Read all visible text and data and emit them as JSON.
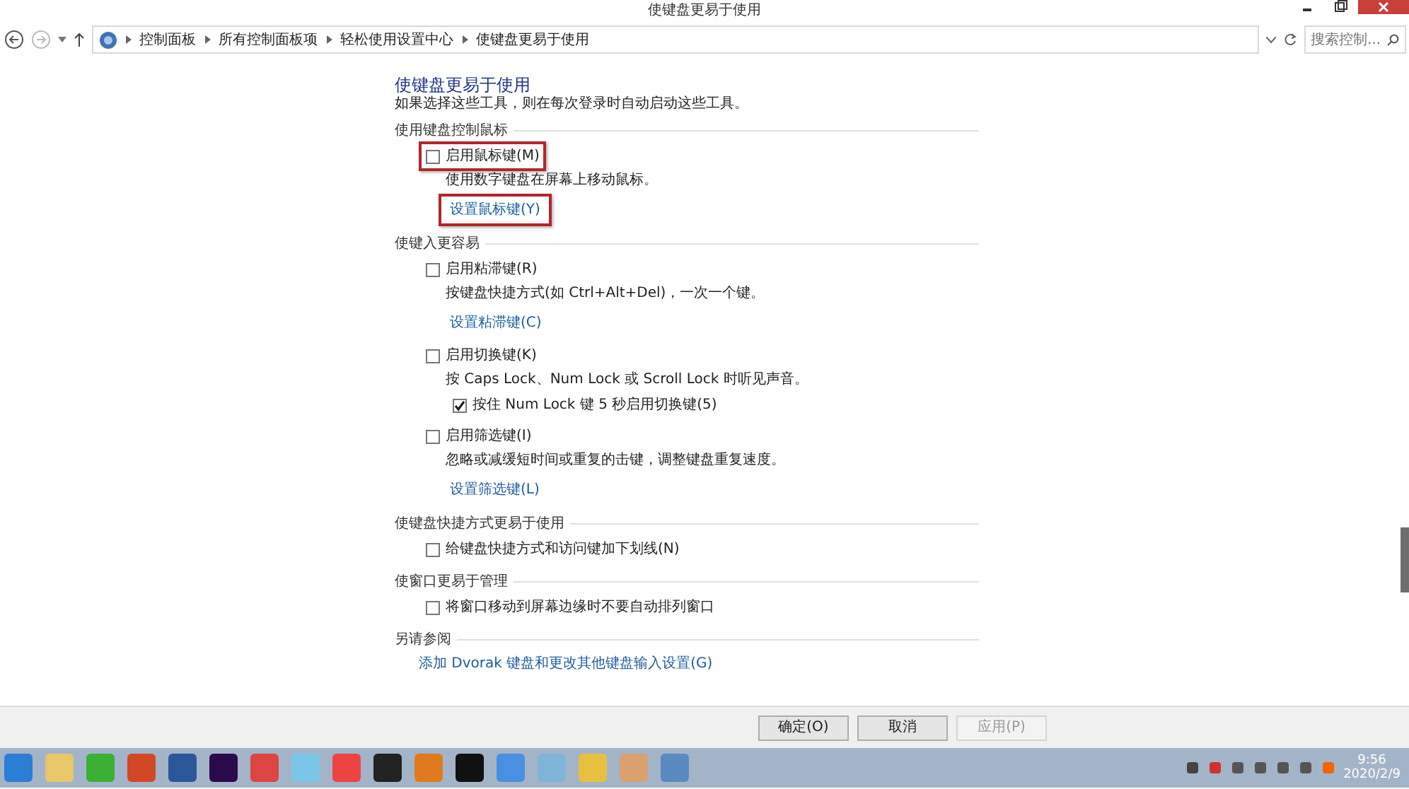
{
  "window": {
    "title": "使键盘更易于使用"
  },
  "address_bar": {
    "breadcrumb": [
      "控制面板",
      "所有控制面板项",
      "轻松使用设置中心",
      "使键盘更易于使用"
    ]
  },
  "search": {
    "placeholder": "搜索控制..."
  },
  "heading": "使键盘更易于使用",
  "subtitle": "如果选择这些工具，则在每次登录时自动启动这些工具。",
  "sections": [
    {
      "title": "使用键盘控制鼠标",
      "items": [
        {
          "kind": "option",
          "label": "启用鼠标键(M)",
          "checked": false,
          "highlighted": true,
          "description": "使用数字键盘在屏幕上移动鼠标。",
          "link": {
            "text": "设置鼠标键(Y)",
            "highlighted": true
          }
        }
      ]
    },
    {
      "title": "使键入更容易",
      "items": [
        {
          "kind": "option",
          "label": "启用粘滞键(R)",
          "checked": false,
          "highlighted": false,
          "description": "按键盘快捷方式(如 Ctrl+Alt+Del)，一次一个键。",
          "link": {
            "text": "设置粘滞键(C)",
            "highlighted": false
          }
        },
        {
          "kind": "option",
          "label": "启用切换键(K)",
          "checked": false,
          "highlighted": false,
          "description": "按 Caps Lock、Num Lock 或 Scroll Lock 时听见声音。",
          "children": [
            {
              "kind": "option",
              "label": "按住 Num Lock 键 5 秒启用切换键(5)",
              "checked": true,
              "highlighted": false
            }
          ]
        },
        {
          "kind": "option",
          "label": "启用筛选键(I)",
          "checked": false,
          "highlighted": false,
          "description": "忽略或减缓短时间或重复的击键，调整键盘重复速度。",
          "link": {
            "text": "设置筛选键(L)",
            "highlighted": false
          }
        }
      ]
    },
    {
      "title": "使键盘快捷方式更易于使用",
      "items": [
        {
          "kind": "option",
          "label": "给键盘快捷方式和访问键加下划线(N)",
          "checked": false,
          "highlighted": false
        }
      ]
    },
    {
      "title": "使窗口更易于管理",
      "items": [
        {
          "kind": "option",
          "label": "将窗口移动到屏幕边缘时不要自动排列窗口",
          "checked": false,
          "highlighted": false
        }
      ]
    },
    {
      "title": "另请参阅",
      "items": [
        {
          "kind": "link",
          "text": "添加 Dvorak 键盘和更改其他键盘输入设置(G)"
        }
      ]
    }
  ],
  "buttons": [
    {
      "label": "确定(O)",
      "disabled": false
    },
    {
      "label": "取消",
      "disabled": false
    },
    {
      "label": "应用(P)",
      "disabled": true
    }
  ],
  "taskbar": {
    "time": "9:56",
    "date": "2020/2/9"
  }
}
